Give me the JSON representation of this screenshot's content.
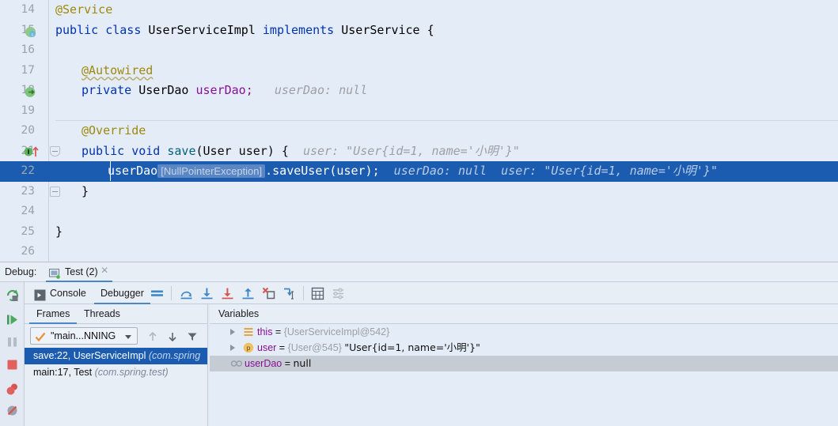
{
  "editor": {
    "lines": [
      {
        "no": "14",
        "indent": 0,
        "gutter": null,
        "tokens": [
          {
            "t": "@Service",
            "c": "ann"
          }
        ]
      },
      {
        "no": "15",
        "indent": 0,
        "gutter": "spring-bean-icon",
        "tokens": [
          {
            "t": "public class ",
            "c": "kw"
          },
          {
            "t": "UserServiceImpl ",
            "c": "cls"
          },
          {
            "t": "implements ",
            "c": "kw"
          },
          {
            "t": "UserService {",
            "c": "cls"
          }
        ]
      },
      {
        "no": "16",
        "indent": 0,
        "gutter": null,
        "tokens": []
      },
      {
        "no": "17",
        "indent": 1,
        "gutter": null,
        "tokens": [
          {
            "t": "@Autowired",
            "c": "ann squig"
          }
        ]
      },
      {
        "no": "18",
        "indent": 1,
        "gutter": "autowired-dependency-icon",
        "tokens": [
          {
            "t": "private ",
            "c": "kw"
          },
          {
            "t": "UserDao ",
            "c": "cls"
          },
          {
            "t": "userDao;",
            "c": "fld"
          },
          {
            "t": "   userDao: null",
            "c": "hint"
          }
        ]
      },
      {
        "no": "19",
        "indent": 0,
        "gutter": null,
        "tokens": []
      },
      {
        "no": "20",
        "indent": 1,
        "gutter": null,
        "tokens": [
          {
            "t": "@Override",
            "c": "ann"
          }
        ]
      },
      {
        "no": "21",
        "indent": 1,
        "gutter": "override-breakpoint-icon",
        "tokens": [
          {
            "t": "public void ",
            "c": "kw"
          },
          {
            "t": "save",
            "c": "mth"
          },
          {
            "t": "(User user) {",
            "c": "pln"
          },
          {
            "t": "  user: \"User{id=1, name='小明'}\"",
            "c": "hint"
          }
        ]
      },
      {
        "no": "22",
        "indent": 2,
        "gutter": null,
        "highlight": true,
        "tokens": [
          {
            "t": "userDao",
            "c": "pln"
          },
          {
            "t": "[NullPointerException]",
            "c": "npe"
          },
          {
            "t": ".saveUser(user);",
            "c": "pln"
          },
          {
            "t": "  userDao: null",
            "c": "hint"
          },
          {
            "t": "  user: \"User{id=1, name='小明'}\"",
            "c": "hint"
          }
        ]
      },
      {
        "no": "23",
        "indent": 1,
        "gutter": null,
        "tokens": [
          {
            "t": "}",
            "c": "pln"
          }
        ]
      },
      {
        "no": "24",
        "indent": 0,
        "gutter": null,
        "tokens": []
      },
      {
        "no": "25",
        "indent": 0,
        "gutter": null,
        "tokens": [
          {
            "t": "}",
            "c": "pln"
          }
        ]
      },
      {
        "no": "26",
        "indent": 0,
        "gutter": null,
        "tokens": []
      }
    ]
  },
  "debug": {
    "label": "Debug:",
    "tab_title": "Test (2)",
    "sidebar": [
      {
        "name": "rerun-icon",
        "title": "Rerun"
      },
      {
        "name": "resume-program-icon",
        "title": "Resume Program"
      },
      {
        "name": "pause-program-icon",
        "title": "Pause Program"
      },
      {
        "name": "stop-icon",
        "title": "Stop"
      },
      {
        "name": "view-breakpoints-icon",
        "title": "View Breakpoints"
      },
      {
        "name": "mute-breakpoints-icon",
        "title": "Mute Breakpoints"
      }
    ],
    "toolbar": {
      "console_tab": "Console",
      "debugger_tab": "Debugger",
      "icons": [
        {
          "name": "show-execution-point-icon",
          "title": "Show Execution Point"
        },
        {
          "name": "step-over-icon",
          "title": "Step Over"
        },
        {
          "name": "step-into-icon",
          "title": "Step Into"
        },
        {
          "name": "force-step-into-icon",
          "title": "Force Step Into"
        },
        {
          "name": "step-out-icon",
          "title": "Step Out"
        },
        {
          "name": "drop-frame-icon",
          "title": "Drop Frame"
        },
        {
          "name": "run-to-cursor-icon",
          "title": "Run to Cursor"
        },
        {
          "name": "evaluate-expression-icon",
          "title": "Evaluate Expression"
        },
        {
          "name": "settings-icon",
          "title": "Layout Settings"
        }
      ]
    },
    "frames": {
      "tab_frames": "Frames",
      "tab_threads": "Threads",
      "thread_selector": "\"main...NNING",
      "items": [
        {
          "text": "save:22, UserServiceImpl ",
          "pkg": "(com.spring",
          "selected": true
        },
        {
          "text": "main:17, Test ",
          "pkg": "(com.spring.test)",
          "selected": false
        }
      ]
    },
    "variables": {
      "title": "Variables",
      "rows": [
        {
          "icon": "field-group-icon",
          "expandable": true,
          "name": "this",
          "eq": " = ",
          "ref": "{UserServiceImpl@542}",
          "str": "",
          "shaded": false
        },
        {
          "icon": "parameter-icon",
          "expandable": true,
          "name": "user",
          "eq": " = ",
          "ref": "{User@545} ",
          "str": "\"User{id=1, name='小明'}\"",
          "shaded": false
        },
        {
          "icon": "field-null-icon",
          "expandable": false,
          "name": "userDao",
          "eq": " = ",
          "ref": "",
          "str": "null",
          "shaded": true
        }
      ]
    }
  }
}
